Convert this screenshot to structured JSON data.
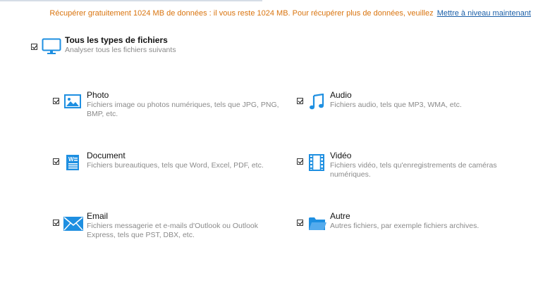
{
  "notice": {
    "message": "Récupérer gratuitement 1024 MB de données : il vous reste 1024 MB. Pour récupérer plus de données, veuillez",
    "upgrade_link": "Mettre à niveau maintenant"
  },
  "all_types": {
    "title": "Tous les types de fichiers",
    "subtitle": "Analyser tous les fichiers suivants",
    "checked": true,
    "icon": "monitor-icon"
  },
  "file_types": [
    {
      "title": "Photo",
      "desc_line1": "Fichiers image ou photos numériques, tels que JPG, PNG,",
      "desc_line2": "BMP, etc.",
      "checked": true,
      "icon": "photo-icon"
    },
    {
      "title": "Audio",
      "desc_line1": "Fichiers audio, tels que MP3, WMA, etc.",
      "desc_line2": "",
      "checked": true,
      "icon": "music-note-icon"
    },
    {
      "title": "Document",
      "desc_line1": "Fichiers bureautiques, tels que Word, Excel, PDF, etc.",
      "desc_line2": "",
      "checked": true,
      "icon": "document-icon"
    },
    {
      "title": "Vidéo",
      "desc_line1": "Fichiers vidéo, tels qu'enregistrements de caméras",
      "desc_line2": "numériques.",
      "checked": true,
      "icon": "film-icon"
    },
    {
      "title": "Email",
      "desc_line1": "Fichiers messagerie et e-mails d'Outlook ou Outlook",
      "desc_line2": "Express, tels que PST, DBX, etc.",
      "checked": true,
      "icon": "envelope-icon"
    },
    {
      "title": "Autre",
      "desc_line1": "Autres fichiers, par exemple fichiers archives.",
      "desc_line2": "",
      "checked": true,
      "icon": "folder-icon"
    }
  ],
  "colors": {
    "accent_blue": "#1e8fe1",
    "notice_orange": "#d9740f",
    "link_blue": "#1b5fa8"
  }
}
